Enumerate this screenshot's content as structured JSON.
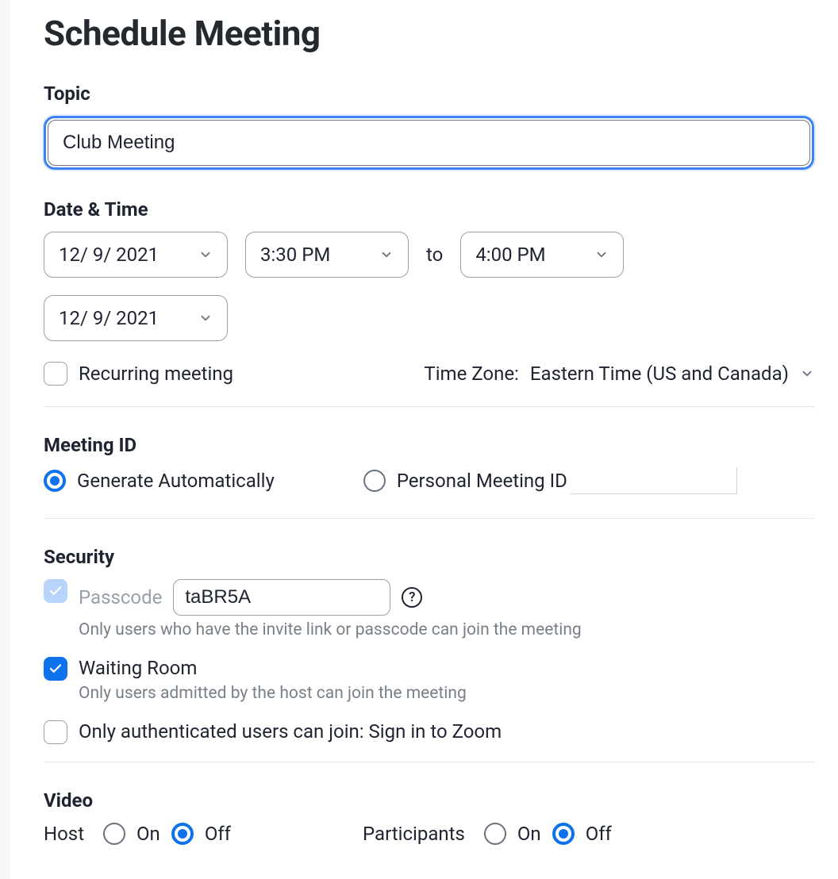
{
  "title": "Schedule Meeting",
  "topic": {
    "label": "Topic",
    "value": "Club Meeting"
  },
  "datetime": {
    "label": "Date & Time",
    "start_date": "12/  9/ 2021",
    "start_time": "3:30 PM",
    "to": "to",
    "end_time": "4:00 PM",
    "end_date": "12/  9/ 2021",
    "recurring_label": "Recurring meeting",
    "tz_label": "Time Zone:",
    "tz_value": "Eastern Time (US and Canada)"
  },
  "meeting_id": {
    "label": "Meeting ID",
    "auto_label": "Generate Automatically",
    "pmi_label": "Personal Meeting ID"
  },
  "security": {
    "label": "Security",
    "passcode_label": "Passcode",
    "passcode_value": "taBR5A",
    "passcode_help": "Only users who have the invite link or passcode can join the meeting",
    "waiting_label": "Waiting Room",
    "waiting_help": "Only users admitted by the host can join the meeting",
    "auth_label": "Only authenticated users can join: Sign in to Zoom",
    "help_icon": "?"
  },
  "video": {
    "label": "Video",
    "host_label": "Host",
    "participants_label": "Participants",
    "on": "On",
    "off": "Off"
  }
}
